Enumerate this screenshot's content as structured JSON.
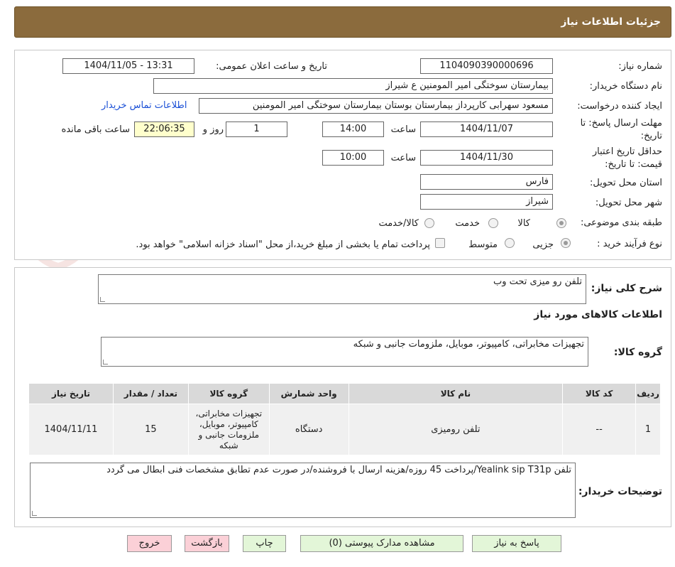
{
  "header": {
    "title": "جزئیات اطلاعات نیاز"
  },
  "watermark": {
    "text": "AriaTender.neT"
  },
  "form": {
    "need_number_label": "شماره نیاز:",
    "need_number": "1104090390000696",
    "announce_label": "تاریخ و ساعت اعلان عمومی:",
    "announce_value": "1404/11/05 - 13:31",
    "buyer_org_label": "نام دستگاه خریدار:",
    "buyer_org": "بیمارستان سوختگی امیر المومنین  ع  شیراز",
    "requester_label": "ایجاد کننده درخواست:",
    "requester": "مسعود سهرابی کارپرداز بیمارستان بوستان بیمارستان سوختگی امیر المومنین",
    "contact_link": "اطلاعات تماس خریدار",
    "deadline_label_1": "مهلت ارسال پاسخ: تا",
    "deadline_label_2": "تاریخ:",
    "deadline_date": "1404/11/07",
    "time_label": "ساعت",
    "deadline_time": "14:00",
    "days_value": "1",
    "days_label": "روز و",
    "remaining_time": "22:06:35",
    "remaining_label": "ساعت باقی مانده",
    "validity_label_1": "حداقل تاریخ اعتبار",
    "validity_label_2": "قیمت: تا تاریخ:",
    "validity_date": "1404/11/30",
    "validity_time": "10:00",
    "province_label": "استان محل تحویل:",
    "province": "فارس",
    "city_label": "شهر محل تحویل:",
    "city": "شیراز",
    "category_label": "طبقه بندی موضوعی:",
    "category_options": [
      "کالا",
      "خدمت",
      "کالا/خدمت"
    ],
    "process_label": "نوع فرآیند خرید :",
    "process_options": [
      "جزیی",
      "متوسط"
    ],
    "treasury_note": "پرداخت تمام یا بخشی از مبلغ خرید،از محل \"اسناد خزانه اسلامی\" خواهد بود."
  },
  "summary": {
    "description_label": "شرح کلی نیاز:",
    "description": "تلفن رو میزی تحت وب",
    "goods_info_title": "اطلاعات کالاهای مورد نیاز",
    "goods_group_label": "گروه کالا:",
    "goods_group": "تجهیزات مخابراتی، کامپیوتر، موبایل، ملزومات جانبی و شبکه"
  },
  "table": {
    "headers": [
      "ردیف",
      "کد کالا",
      "نام کالا",
      "واحد شمارش",
      "گروه کالا",
      "تعداد / مقدار",
      "تاریخ نیاز"
    ],
    "rows": [
      {
        "row": "1",
        "code": "--",
        "name": "تلفن رومیزی",
        "unit": "دستگاه",
        "group": "تجهیزات مخابراتی، کامپیوتر، موبایل، ملزومات جانبی و شبکه",
        "qty": "15",
        "date": "1404/11/11"
      }
    ]
  },
  "buyer_notes": {
    "label": "توضیحات خریدار:",
    "text": "تلفن Yealink sip T31p/پرداخت 45 روزه/هزینه ارسال با فروشنده/در صورت عدم تطابق مشخصات فنی ابطال می گردد"
  },
  "buttons": {
    "reply": "پاسخ به نیاز",
    "attachments": "مشاهده مدارک پیوستی (0)",
    "print": "چاپ",
    "back": "بازگشت",
    "exit": "خروج"
  },
  "colors": {
    "header_bg": "#8b6b3d",
    "link": "#1a4fd6",
    "yellow_box": "#ffffcc",
    "green_btn": "#e3f6d8",
    "pink_btn": "#fbd0d7"
  }
}
